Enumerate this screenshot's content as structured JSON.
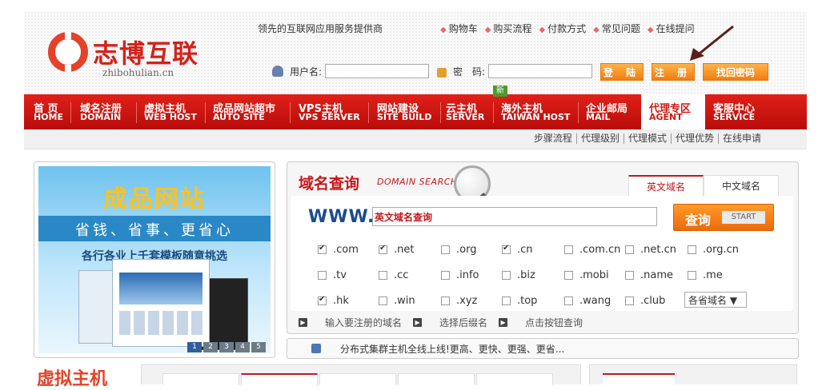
{
  "header": {
    "logo_text": "志博互联",
    "logo_sub": "zhibohulian.cn",
    "slogan": "领先的互联网应用服务提供商",
    "top_links": [
      "购物车",
      "购买流程",
      "付款方式",
      "常见问题",
      "在线提问"
    ],
    "username_label": "用户名:",
    "password_label": "密　码:",
    "login_button": "登 陆",
    "register_button": "注 册",
    "forgot_button": "找回密码"
  },
  "nav": {
    "items": [
      {
        "cn": "首 页",
        "en": "HOME"
      },
      {
        "cn": "域名注册",
        "en": "DOMAIN"
      },
      {
        "cn": "虚拟主机",
        "en": "WEB HOST"
      },
      {
        "cn": "成品网站超市",
        "en": "AUTO SITE"
      },
      {
        "cn": "VPS主机",
        "en": "VPS SERVER"
      },
      {
        "cn": "网站建设",
        "en": "SITE BUILD"
      },
      {
        "cn": "云主机",
        "en": "SERVER"
      },
      {
        "cn": "海外主机",
        "en": "TAIWAN HOST"
      },
      {
        "cn": "企业邮局",
        "en": "MAIL"
      },
      {
        "cn": "代理专区",
        "en": "AGENT"
      },
      {
        "cn": "客服中心",
        "en": "SERVICE"
      }
    ],
    "new_badge": "新"
  },
  "subnav": [
    "步骤流程",
    "代理级别",
    "代理模式",
    "代理优势",
    "在线申请"
  ],
  "banner": {
    "title": "成品网站",
    "subtitle": "省钱、省事、更省心",
    "subtitle2": "各行各业上千套模板随意挑选",
    "pages": [
      "1",
      "2",
      "3",
      "4",
      "5"
    ]
  },
  "domain": {
    "title": "域名查询",
    "title_en": "DOMAIN SEARCH",
    "tabs": [
      "英文域名",
      "中文域名"
    ],
    "prefix": "WWW.",
    "search_value": "英文域名查询",
    "search_cn": "查询",
    "search_en": "START",
    "tlds": [
      {
        "name": ".com",
        "checked": true
      },
      {
        "name": ".net",
        "checked": true
      },
      {
        "name": ".org",
        "checked": false
      },
      {
        "name": ".cn",
        "checked": true
      },
      {
        "name": ".com.cn",
        "checked": false
      },
      {
        "name": ".net.cn",
        "checked": false
      },
      {
        "name": ".org.cn",
        "checked": false
      },
      {
        "name": ".tv",
        "checked": false
      },
      {
        "name": ".cc",
        "checked": false
      },
      {
        "name": ".info",
        "checked": false
      },
      {
        "name": ".biz",
        "checked": false
      },
      {
        "name": ".mobi",
        "checked": false
      },
      {
        "name": ".name",
        "checked": false
      },
      {
        "name": ".me",
        "checked": false
      },
      {
        "name": ".hk",
        "checked": true
      },
      {
        "name": ".win",
        "checked": false
      },
      {
        "name": ".xyz",
        "checked": false
      },
      {
        "name": ".top",
        "checked": false
      },
      {
        "name": ".wang",
        "checked": false
      },
      {
        "name": ".club",
        "checked": false
      }
    ],
    "province_select": "各省域名 ▼",
    "steps": [
      "输入要注册的域名",
      "选择后缀名",
      "点击按钮查询"
    ]
  },
  "notice": "分布式集群主机全线上线!更高、更快、更强、更省...",
  "bottom": {
    "vhost_title": "虚拟主机"
  }
}
